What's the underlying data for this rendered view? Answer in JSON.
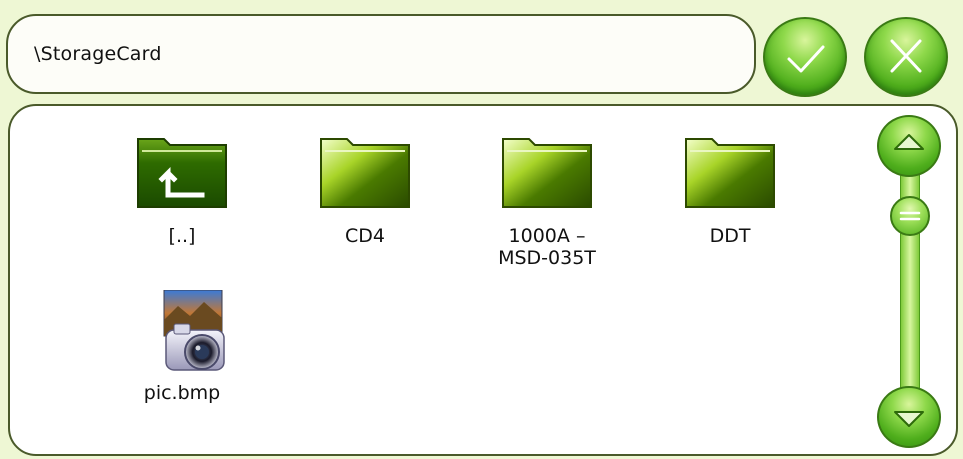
{
  "path_bar": {
    "value": "\\StorageCard"
  },
  "toolbar": {
    "ok_icon": "checkmark-icon",
    "cancel_icon": "close-icon"
  },
  "files": [
    {
      "label": "[..]",
      "icon": "folder-up-icon"
    },
    {
      "label": "CD4",
      "icon": "folder-icon"
    },
    {
      "label": "1000A – MSD-035T",
      "icon": "folder-icon"
    },
    {
      "label": "DDT",
      "icon": "folder-icon"
    },
    {
      "label": "pic.bmp",
      "icon": "camera-image-icon"
    }
  ],
  "scrollbar": {
    "up_icon": "arrow-up-icon",
    "down_icon": "arrow-down-icon",
    "thumb_icon": "scroll-thumb-icon"
  },
  "colors": {
    "background": "#eef7d4",
    "accent_green": "#4fae1c",
    "folder_green": "#3d6e00"
  }
}
